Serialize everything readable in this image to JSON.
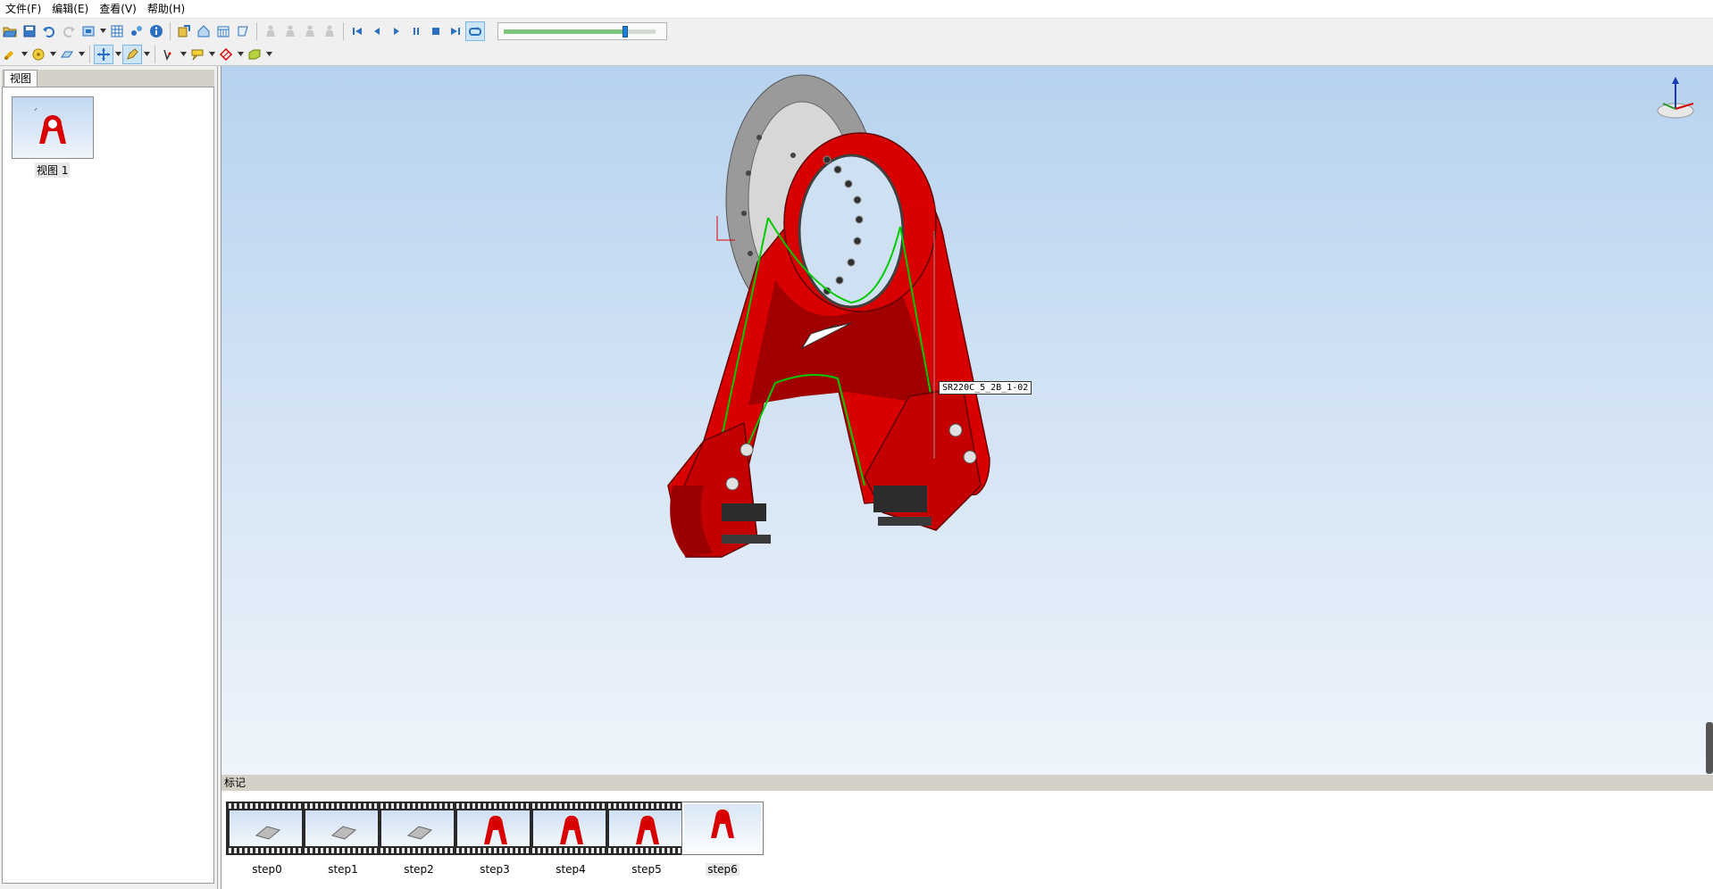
{
  "menu": {
    "items": [
      "文件(F)",
      "编辑(E)",
      "查看(V)",
      "帮助(H)"
    ]
  },
  "toolbar": {
    "row1_icons": [
      "open-icon",
      "save-icon",
      "undo-icon",
      "redo-icon",
      "fit-view-icon",
      "grid-icon",
      "explode-icon",
      "info-icon",
      "export-icon",
      "home-view-icon",
      "calendar-icon",
      "tilt-view-icon",
      "figure-icon",
      "figure-icon",
      "figure-icon",
      "figure-icon",
      "first-frame-icon",
      "prev-frame-icon",
      "play-icon",
      "pause-icon",
      "stop-icon",
      "last-frame-icon",
      "loop-icon"
    ],
    "row2_icons": [
      "light-icon",
      "render-icon",
      "section-icon",
      "move-icon",
      "paint-icon",
      "measure-icon",
      "annotation-icon",
      "eraser-icon",
      "hide-icon"
    ],
    "playback_progress": 0.8
  },
  "left_panel": {
    "tab_label": "视图",
    "views": [
      {
        "label": "视图 1"
      }
    ]
  },
  "viewport": {
    "callout_text": "SR220C_5_2B_1-02",
    "model_color": "#d80000",
    "highlight_color": "#00cc00"
  },
  "markers": {
    "header": "标记",
    "items": [
      {
        "label": "step0",
        "selected": false
      },
      {
        "label": "step1",
        "selected": false
      },
      {
        "label": "step2",
        "selected": false
      },
      {
        "label": "step3",
        "selected": false
      },
      {
        "label": "step4",
        "selected": false
      },
      {
        "label": "step5",
        "selected": false
      },
      {
        "label": "step6",
        "selected": true
      }
    ]
  }
}
